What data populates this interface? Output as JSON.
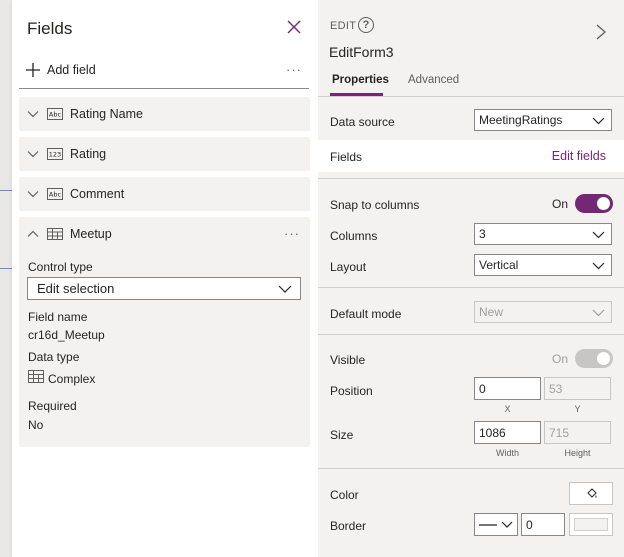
{
  "fields_panel": {
    "title": "Fields",
    "add_field_label": "Add field",
    "more_label": "···",
    "items": [
      {
        "label": "Rating Name",
        "type_icon": "abc-icon"
      },
      {
        "label": "Rating",
        "type_icon": "123-icon"
      },
      {
        "label": "Comment",
        "type_icon": "abc-icon"
      },
      {
        "label": "Meetup",
        "type_icon": "complex-icon"
      }
    ],
    "expanded": {
      "control_type_label": "Control type",
      "control_type_value": "Edit selection",
      "field_name_label": "Field name",
      "field_name_value": "cr16d_Meetup",
      "data_type_label": "Data type",
      "data_type_value": "Complex",
      "required_label": "Required",
      "required_value": "No"
    }
  },
  "properties": {
    "header_label": "EDIT",
    "help_glyph": "?",
    "control_name": "EditForm3",
    "tabs": [
      {
        "label": "Properties",
        "active": true
      },
      {
        "label": "Advanced",
        "active": false
      }
    ],
    "data_source_label": "Data source",
    "data_source_value": "MeetingRatings",
    "fields_label": "Fields",
    "edit_fields_link": "Edit fields",
    "snap_label": "Snap to columns",
    "snap_state": "On",
    "columns_label": "Columns",
    "columns_value": "3",
    "layout_label": "Layout",
    "layout_value": "Vertical",
    "default_mode_label": "Default mode",
    "default_mode_value": "New",
    "visible_label": "Visible",
    "visible_state": "On",
    "position_label": "Position",
    "position_x": "0",
    "position_y": "53",
    "x_label": "X",
    "y_label": "Y",
    "size_label": "Size",
    "width_value": "1086",
    "height_value": "715",
    "width_label": "Width",
    "height_label": "Height",
    "color_label": "Color",
    "border_label": "Border",
    "border_width_value": "0"
  },
  "colors": {
    "accent": "#742774",
    "toggle_disabled": "#c8c6c4"
  }
}
